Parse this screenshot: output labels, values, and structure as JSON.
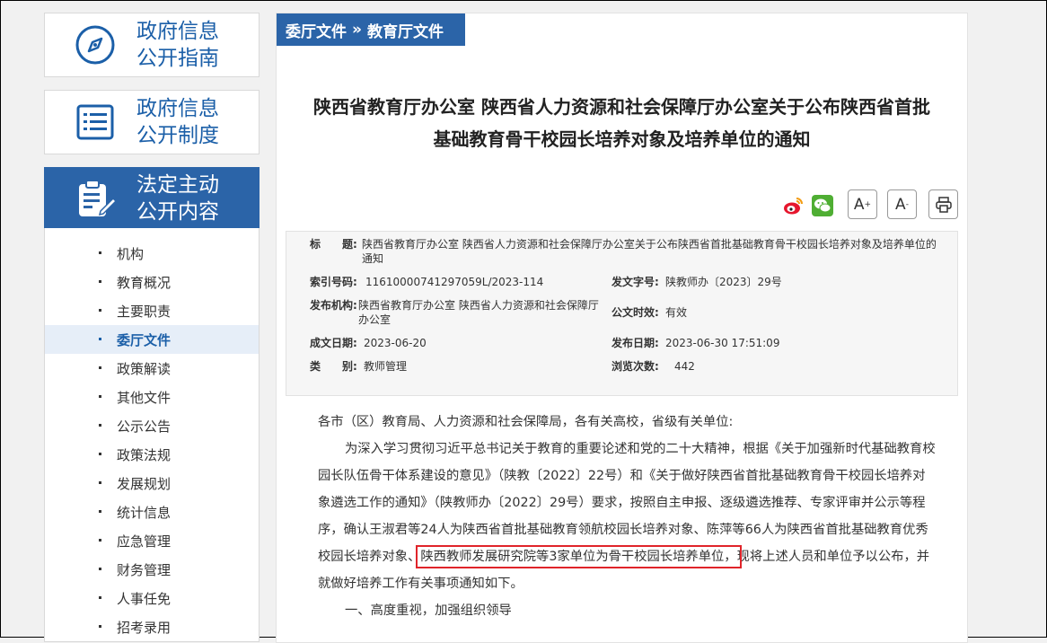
{
  "sidebar": {
    "cards": [
      {
        "line1": "政府信息",
        "line2": "公开指南",
        "icon": "compass-icon"
      },
      {
        "line1": "政府信息",
        "line2": "公开制度",
        "icon": "list-icon"
      },
      {
        "line1": "法定主动",
        "line2": "公开内容",
        "icon": "clipboard-edit-icon"
      }
    ],
    "items": [
      {
        "label": "机构"
      },
      {
        "label": "教育概况"
      },
      {
        "label": "主要职责"
      },
      {
        "label": "委厅文件"
      },
      {
        "label": "政策解读"
      },
      {
        "label": "其他文件"
      },
      {
        "label": "公示公告"
      },
      {
        "label": "政策法规"
      },
      {
        "label": "发展规划"
      },
      {
        "label": "统计信息"
      },
      {
        "label": "应急管理"
      },
      {
        "label": "财务管理"
      },
      {
        "label": "人事任免"
      },
      {
        "label": "招考录用"
      }
    ]
  },
  "breadcrumb": {
    "part1": "委厅文件",
    "sep": "»",
    "part2": "教育厅文件"
  },
  "article": {
    "title_line1": "陕西省教育厅办公室 陕西省人力资源和社会保障厅办公室关于公布陕西省首批",
    "title_line2": "基础教育骨干校园长培养对象及培养单位的通知",
    "font_larger": "A",
    "font_larger_sup": "+",
    "font_smaller": "A",
    "font_smaller_sup": "-",
    "meta": {
      "title_key": "标　　题:",
      "title_val": "陕西省教育厅办公室 陕西省人力资源和社会保障厅办公室关于公布陕西省首批基础教育骨干校园长培养对象及培养单位的通知",
      "index_key": "索引号码:",
      "index_val": "11610000741297059L/2023-114",
      "docno_key": "发文字号:",
      "docno_val": "陕教师办〔2023〕29号",
      "org_key": "发布机构:",
      "org_val": "陕西省教育厅办公室 陕西省人力资源和社会保障厅办公室",
      "valid_key": "公文时效:",
      "valid_val": "有效",
      "made_key": "成文日期:",
      "made_val": "2023-06-20",
      "pub_key": "发布日期:",
      "pub_val": "2023-06-30 17:51:09",
      "cat_key": "类　　别:",
      "cat_val": "教师管理",
      "views_key": "浏览次数:",
      "views_val": "442"
    },
    "salutation": "各市（区）教育局、人力资源和社会保障局，各有关高校，省级有关单位:",
    "para1_a": "为深入学习贯彻习近平总书记关于教育的重要论述和党的二十大精神，根据《关于加强新时代基础教育校园长队伍骨干体系建设的意见》（陕教〔2022〕22号）和《关于做好陕西省首批基础教育骨干校园长培养对象遴选工作的通知》（陕教师办〔2022〕29号）要求，按照自主申报、逐级遴选推荐、专家评审并公示等程序，确认王淑君等24人为陕西省首批基础教育领航校园长培养对象、陈萍等66人为陕西省首批基础教育优秀校园长培养对象、",
    "para1_hl": "陕西教师发展研究院等3家单位为骨干校园长培养单位，",
    "para1_b": "现将上述人员和单位予以公布，并就做好培养工作有关事项通知如下。",
    "section1": "一、高度重视，加强组织领导"
  }
}
